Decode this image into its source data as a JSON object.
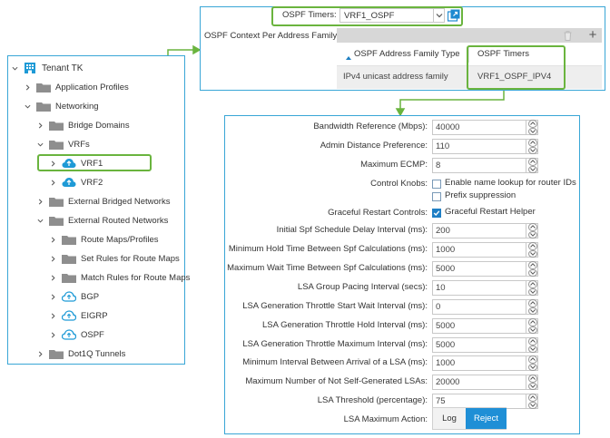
{
  "tree": {
    "root": "Tenant TK",
    "items": [
      {
        "label": "Application Profiles"
      },
      {
        "label": "Networking"
      },
      {
        "label": "Bridge Domains"
      },
      {
        "label": "VRFs"
      },
      {
        "label": "VRF1"
      },
      {
        "label": "VRF2"
      },
      {
        "label": "External Bridged Networks"
      },
      {
        "label": "External Routed Networks"
      },
      {
        "label": "Route Maps/Profiles"
      },
      {
        "label": "Set Rules for Route Maps"
      },
      {
        "label": "Match Rules for Route Maps"
      },
      {
        "label": "BGP"
      },
      {
        "label": "EIGRP"
      },
      {
        "label": "OSPF"
      },
      {
        "label": "Dot1Q Tunnels"
      }
    ]
  },
  "top": {
    "ospf_timers_label": "OSPF Timers:",
    "ospf_timers_value": "VRF1_OSPF",
    "context_label": "OSPF Context Per Address Family:",
    "add_icon": "+",
    "col_af_type": "OSPF Address Family Type",
    "col_timers": "OSPF Timers",
    "row_af_type": "IPv4 unicast address family",
    "row_timers": "VRF1_OSPF_IPV4"
  },
  "form": {
    "bandwidth_label": "Bandwidth Reference (Mbps):",
    "bandwidth_value": "40000",
    "admin_distance_label": "Admin Distance Preference:",
    "admin_distance_value": "110",
    "max_ecmp_label": "Maximum ECMP:",
    "max_ecmp_value": "8",
    "control_knobs_label": "Control Knobs:",
    "knob_name_lookup": "Enable name lookup for router IDs",
    "knob_prefix_suppression": "Prefix suppression",
    "graceful_restart_label": "Graceful Restart Controls:",
    "graceful_restart_helper": "Graceful Restart Helper",
    "initial_spf_label": "Initial Spf Schedule Delay Interval (ms):",
    "initial_spf_value": "200",
    "min_hold_label": "Minimum Hold Time Between Spf Calculations (ms):",
    "min_hold_value": "1000",
    "max_wait_label": "Maximum Wait Time Between Spf Calculations (ms):",
    "max_wait_value": "5000",
    "lsa_group_pacing_label": "LSA Group Pacing Interval (secs):",
    "lsa_group_pacing_value": "10",
    "lsa_start_wait_label": "LSA Generation Throttle Start Wait Interval (ms):",
    "lsa_start_wait_value": "0",
    "lsa_hold_label": "LSA Generation Throttle Hold Interval (ms):",
    "lsa_hold_value": "5000",
    "lsa_max_label": "LSA Generation Throttle Maximum Interval (ms):",
    "lsa_max_value": "5000",
    "min_arrival_label": "Minimum Interval Between Arrival of a LSA (ms):",
    "min_arrival_value": "1000",
    "max_not_self_label": "Maximum Number of Not Self-Generated LSAs:",
    "max_not_self_value": "20000",
    "lsa_threshold_label": "LSA Threshold (percentage):",
    "lsa_threshold_value": "75",
    "lsa_max_action_label": "LSA Maximum Action:",
    "action_log": "Log",
    "action_reject": "Reject"
  },
  "colors": {
    "panel_border": "#39a6d6",
    "highlight_green": "#6ab43e",
    "reject_blue": "#1f8fd6",
    "cloud_blue": "#1e9ad6",
    "folder_gray": "#8e8e8e"
  }
}
